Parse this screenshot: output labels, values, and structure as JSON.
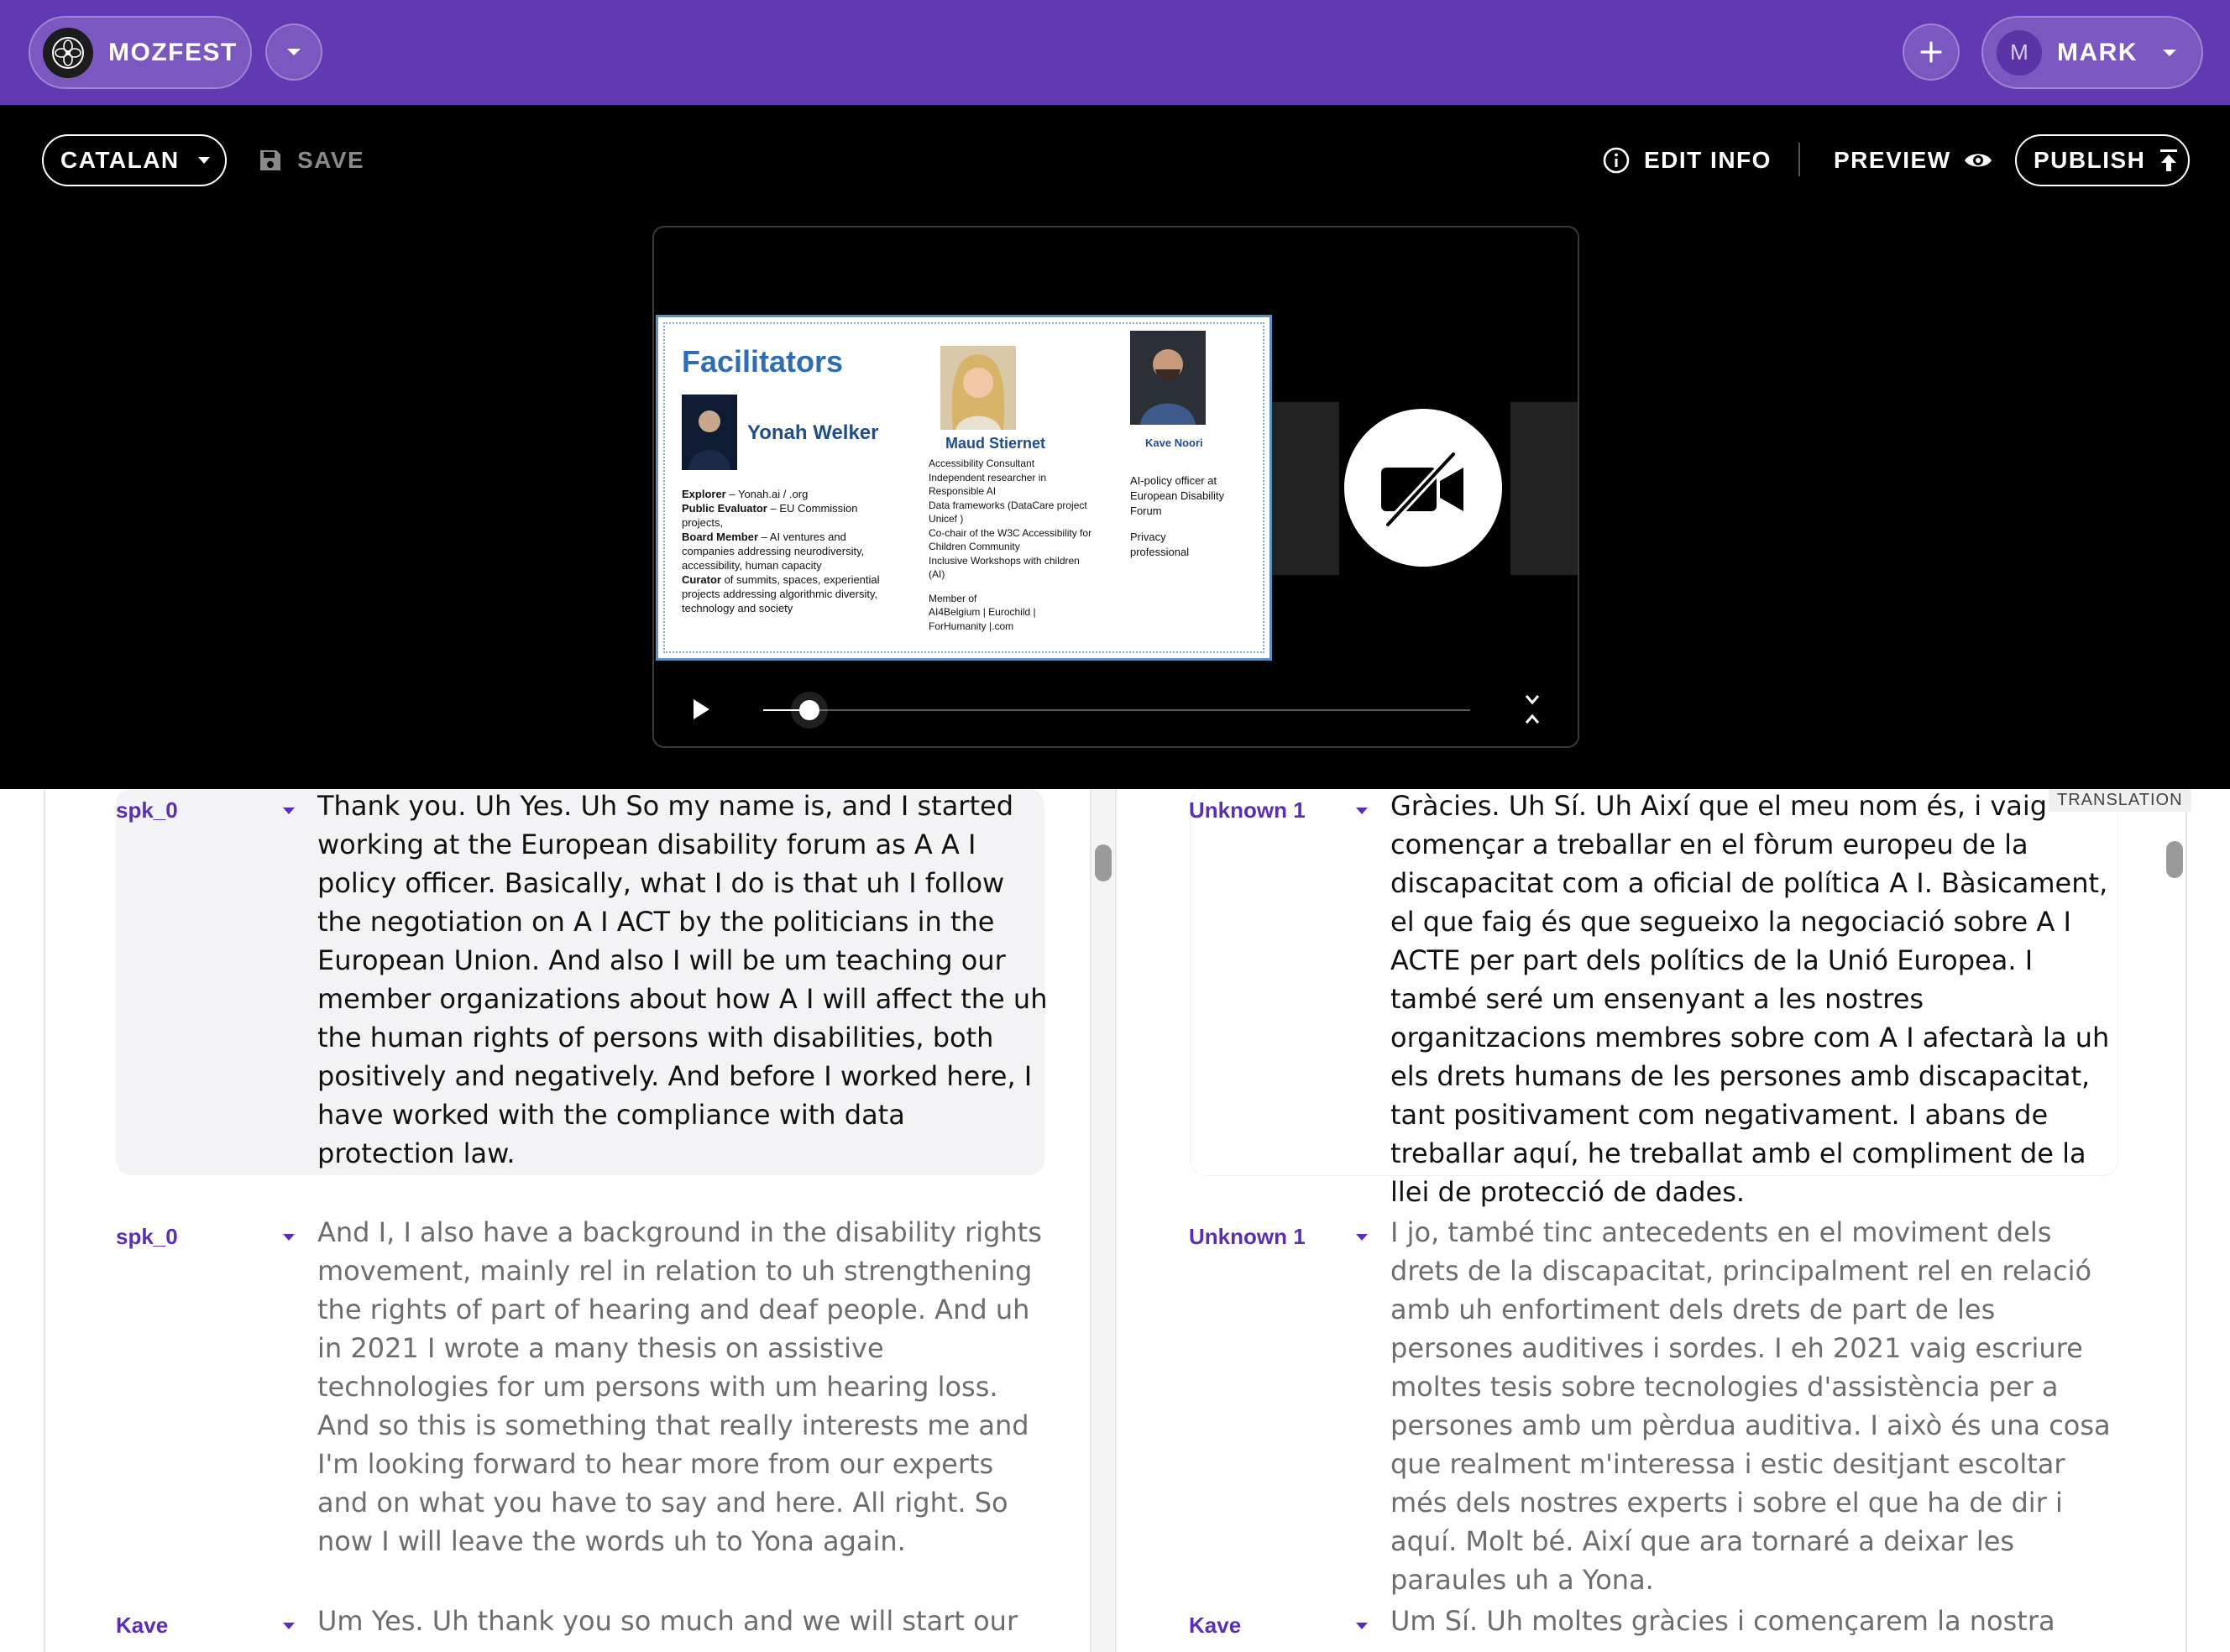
{
  "app": {
    "brand": "MOZFEST",
    "user_initial": "M",
    "user_name": "MARK"
  },
  "toolbar": {
    "language": "CATALAN",
    "save_label": "SAVE",
    "edit_info_label": "EDIT INFO",
    "preview_label": "PREVIEW",
    "publish_label": "PUBLISH"
  },
  "player": {
    "progress_fraction": 0.065,
    "slide": {
      "title": "Facilitators",
      "person1": {
        "name": "Yonah Welker",
        "lines": [
          "<b>Explorer</b> – Yonah.ai / .org",
          "<b>Public Evaluator</b> – EU Commission",
          "projects,",
          "<b>Board Member</b> – AI ventures and",
          "companies addressing  neurodiversity,",
          "accessibility, human capacity",
          "<b>Curator</b> of summits, spaces, experiential",
          "projects addressing algorithmic diversity,",
          "technology and society"
        ]
      },
      "person2": {
        "name": "Maud Stiernet",
        "lines": [
          "Accessibility Consultant",
          "Independent researcher in",
          "Responsible AI",
          "Data frameworks (DataCare project",
          "Unicef )",
          "Co-chair of the W3C Accessibility for",
          "Children Community",
          "Inclusive Workshops with children",
          "(AI)",
          "",
          "Member of",
          "AI4Belgium | Eurochild |",
          "ForHumanity |.com"
        ]
      },
      "person3": {
        "name": "Kave Noori",
        "lines": [
          "AI-policy officer at",
          "European Disability",
          "Forum",
          "",
          "Privacy",
          "professional"
        ]
      }
    }
  },
  "transcript": {
    "translation_tag": "TRANSLATION",
    "source": [
      {
        "speaker": "spk_0",
        "text": "Thank you. Uh Yes. Uh So my name is, and I started working at the European disability forum as A A I policy officer. Basically, what I do is that uh I follow the negotiation on A I ACT by the politicians in the European Union. And also I will be um teaching our member organizations about how A I will affect the uh the human rights of persons with disabilities, both positively and negatively. And before I worked here, I have worked with the compliance with data protection law."
      },
      {
        "speaker": "spk_0",
        "text": "And I, I also have a background in the disability rights movement, mainly rel in relation to uh strengthening the rights of part of hearing and deaf people. And uh in 2021 I wrote a many thesis on assistive technologies for um persons with um hearing loss. And so this is something that really interests me and I'm looking forward to hear more from our experts and on what you have to say and here. All right. So now I will leave the words uh to Yona again."
      },
      {
        "speaker": "Kave",
        "text": "Um Yes. Uh thank you so much and we will start our"
      }
    ],
    "translation": [
      {
        "speaker": "Unknown 1",
        "text": "Gràcies. Uh Sí. Uh Així que el meu nom és, i vaig començar a treballar en el fòrum europeu de la discapacitat com a oficial de política A I. Bàsicament, el que faig és que segueixo la negociació sobre A I ACTE per part dels polítics de la Unió Europea. I també seré um ensenyant a les nostres organitzacions membres sobre com A I afectarà la uh els drets humans de les persones amb discapacitat, tant positivament com negativament. I abans de treballar aquí, he treballat amb el compliment de la llei de protecció de dades."
      },
      {
        "speaker": "Unknown 1",
        "text": "I jo, també tinc antecedents en el moviment dels drets de la discapacitat, principalment rel en relació amb uh enfortiment dels drets de part de les persones auditives i sordes. I eh 2021 vaig escriure moltes tesis sobre tecnologies d'assistència per a persones amb um pèrdua auditiva. I això és una cosa que realment m'interessa i estic desitjant escoltar més dels nostres experts i sobre el que ha de dir i aquí. Molt bé. Així que ara tornaré a deixar les paraules uh a Yona."
      },
      {
        "speaker": "Kave",
        "text": "Um Sí. Uh moltes gràcies i començarem la nostra"
      }
    ]
  }
}
